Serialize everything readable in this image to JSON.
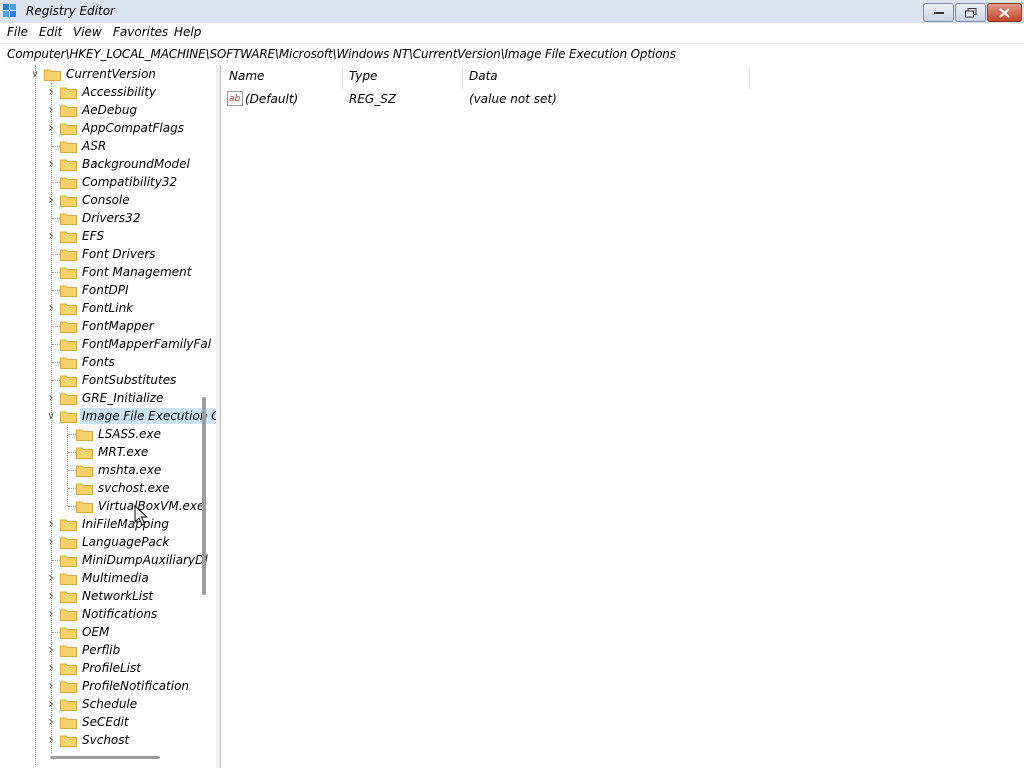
{
  "window": {
    "title": "Registry Editor"
  },
  "menu": [
    "File",
    "Edit",
    "View",
    "Favorites",
    "Help"
  ],
  "address": "Computer\\HKEY_LOCAL_MACHINE\\SOFTWARE\\Microsoft\\Windows NT\\CurrentVersion\\Image File Execution Options",
  "tree": {
    "root": {
      "label": "CurrentVersion",
      "expanded": true
    },
    "items": [
      {
        "label": "Accessibility",
        "level": 1,
        "expandable": true
      },
      {
        "label": "AeDebug",
        "level": 1,
        "expandable": true
      },
      {
        "label": "AppCompatFlags",
        "level": 1,
        "expandable": true
      },
      {
        "label": "ASR",
        "level": 1,
        "expandable": false
      },
      {
        "label": "BackgroundModel",
        "level": 1,
        "expandable": true
      },
      {
        "label": "Compatibility32",
        "level": 1,
        "expandable": false
      },
      {
        "label": "Console",
        "level": 1,
        "expandable": true
      },
      {
        "label": "Drivers32",
        "level": 1,
        "expandable": false
      },
      {
        "label": "EFS",
        "level": 1,
        "expandable": true
      },
      {
        "label": "Font Drivers",
        "level": 1,
        "expandable": false
      },
      {
        "label": "Font Management",
        "level": 1,
        "expandable": false
      },
      {
        "label": "FontDPI",
        "level": 1,
        "expandable": false
      },
      {
        "label": "FontLink",
        "level": 1,
        "expandable": true
      },
      {
        "label": "FontMapper",
        "level": 1,
        "expandable": false
      },
      {
        "label": "FontMapperFamilyFal",
        "level": 1,
        "expandable": false
      },
      {
        "label": "Fonts",
        "level": 1,
        "expandable": false
      },
      {
        "label": "FontSubstitutes",
        "level": 1,
        "expandable": false
      },
      {
        "label": "GRE_Initialize",
        "level": 1,
        "expandable": true
      },
      {
        "label": "Image File Execution C",
        "level": 1,
        "expandable": true,
        "expanded": true,
        "selected": true
      },
      {
        "label": "LSASS.exe",
        "level": 2,
        "expandable": false
      },
      {
        "label": "MRT.exe",
        "level": 2,
        "expandable": false
      },
      {
        "label": "mshta.exe",
        "level": 2,
        "expandable": false
      },
      {
        "label": "svchost.exe",
        "level": 2,
        "expandable": false
      },
      {
        "label": "VirtualBoxVM.exe",
        "level": 2,
        "expandable": false
      },
      {
        "label": "IniFileMapping",
        "level": 1,
        "expandable": true
      },
      {
        "label": "LanguagePack",
        "level": 1,
        "expandable": true
      },
      {
        "label": "MiniDumpAuxiliaryDl",
        "level": 1,
        "expandable": false
      },
      {
        "label": "Multimedia",
        "level": 1,
        "expandable": true
      },
      {
        "label": "NetworkList",
        "level": 1,
        "expandable": true
      },
      {
        "label": "Notifications",
        "level": 1,
        "expandable": true
      },
      {
        "label": "OEM",
        "level": 1,
        "expandable": false
      },
      {
        "label": "Perflib",
        "level": 1,
        "expandable": true
      },
      {
        "label": "ProfileList",
        "level": 1,
        "expandable": true
      },
      {
        "label": "ProfileNotification",
        "level": 1,
        "expandable": true
      },
      {
        "label": "Schedule",
        "level": 1,
        "expandable": true
      },
      {
        "label": "SeCEdit",
        "level": 1,
        "expandable": true
      },
      {
        "label": "Svchost",
        "level": 1,
        "expandable": true
      }
    ]
  },
  "list": {
    "columns": [
      "Name",
      "Type",
      "Data"
    ],
    "rows": [
      {
        "name": "(Default)",
        "type": "REG_SZ",
        "data": "(value not set)",
        "icon": "string-value-icon"
      }
    ]
  },
  "colors": {
    "titlebar": "#dce4ef",
    "selection": "#cce4f7",
    "folder": "#f6d26b",
    "close": "#c4452c"
  }
}
